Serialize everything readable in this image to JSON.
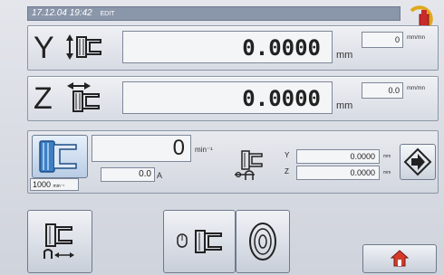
{
  "status": {
    "datetime": "17.12.04 19:42",
    "mode": "EDIT"
  },
  "axes": [
    {
      "letter": "Y",
      "position": "0.0000",
      "unit": "mm",
      "feed": "0",
      "feed_unit": "mm/mn"
    },
    {
      "letter": "Z",
      "position": "0.0000",
      "unit": "mm",
      "feed": "0.0",
      "feed_unit": "mm/mn"
    }
  ],
  "spindle": {
    "rpm": "0",
    "rpm_unit": "min⁻¹",
    "speed_setting": "1000",
    "speed_unit": "min⁻¹",
    "load": "0.0",
    "load_unit": "A"
  },
  "relative": [
    {
      "label": "Y",
      "value": "0.0000",
      "unit": "mm"
    },
    {
      "label": "Z",
      "value": "0.0000",
      "unit": "mm"
    }
  ],
  "icons": {
    "tool": "tool-warning-icon",
    "spindle": "spindle-icon",
    "relative": "relative-position-icon",
    "next": "arrow-right-icon",
    "home": "home-icon",
    "softkeys": [
      "tool-retract-icon",
      "tool-clamp-icon",
      "grinding-wheel-icon"
    ]
  },
  "colors": {
    "accent": "#2d6fb4",
    "warning": "#e0a81a",
    "home_red": "#d43a2a"
  }
}
